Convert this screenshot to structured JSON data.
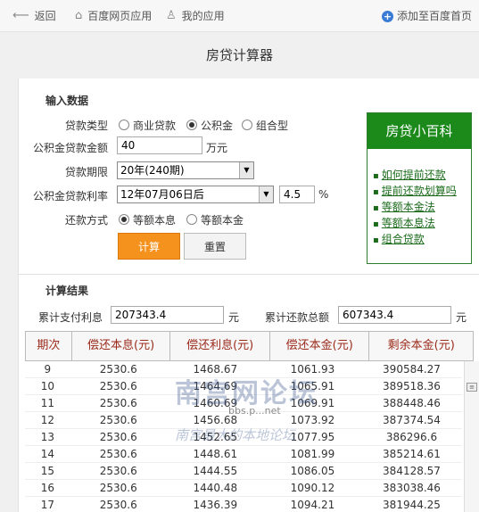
{
  "topbar": {
    "back": "返回",
    "web_apps": "百度网页应用",
    "my_apps": "我的应用",
    "add_home": "添加至百度首页"
  },
  "page_title": "房贷计算器",
  "input": {
    "section_title": "输入数据",
    "loan_type_label": "贷款类型",
    "loan_type_options": [
      "商业贷款",
      "公积金",
      "组合型"
    ],
    "loan_type_selected": "公积金",
    "amount_label": "公积金贷款金额",
    "amount_value": "40",
    "amount_unit": "万元",
    "term_label": "贷款期限",
    "term_value": "20年(240期)",
    "rate_label": "公积金贷款利率",
    "rate_date": "12年07月06日后",
    "rate_value": "4.5",
    "rate_unit": "%",
    "method_label": "还款方式",
    "method_options": [
      "等额本息",
      "等额本金"
    ],
    "method_selected": "等额本息",
    "calc_button": "计算",
    "reset_button": "重置"
  },
  "wiki": {
    "title": "房贷小百科",
    "links": [
      "如何提前还款",
      "提前还款划算吗",
      "等额本金法",
      "等额本息法",
      "组合贷款"
    ]
  },
  "result": {
    "section_title": "计算结果",
    "interest_label": "累计支付利息",
    "interest_value": "207343.4",
    "total_label": "累计还款总额",
    "total_value": "607343.4",
    "unit": "元"
  },
  "table": {
    "headers": [
      "期次",
      "偿还本息(元)",
      "偿还利息(元)",
      "偿还本金(元)",
      "剩余本金(元)"
    ],
    "rows": [
      [
        "9",
        "2530.6",
        "1468.67",
        "1061.93",
        "390584.27"
      ],
      [
        "10",
        "2530.6",
        "1464.69",
        "1065.91",
        "389518.36"
      ],
      [
        "11",
        "2530.6",
        "1460.69",
        "1069.91",
        "388448.46"
      ],
      [
        "12",
        "2530.6",
        "1456.68",
        "1073.92",
        "387374.54"
      ],
      [
        "13",
        "2530.6",
        "1452.65",
        "1077.95",
        "386296.6"
      ],
      [
        "14",
        "2530.6",
        "1448.61",
        "1081.99",
        "385214.61"
      ],
      [
        "15",
        "2530.6",
        "1444.55",
        "1086.05",
        "384128.57"
      ],
      [
        "16",
        "2530.6",
        "1440.48",
        "1090.12",
        "383038.46"
      ],
      [
        "17",
        "2530.6",
        "1436.39",
        "1094.21",
        "381944.25"
      ]
    ]
  },
  "watermark": {
    "title": "南宫网论坛",
    "url": "bbs.p...net",
    "slogan": "南宫最大的本地论坛"
  }
}
